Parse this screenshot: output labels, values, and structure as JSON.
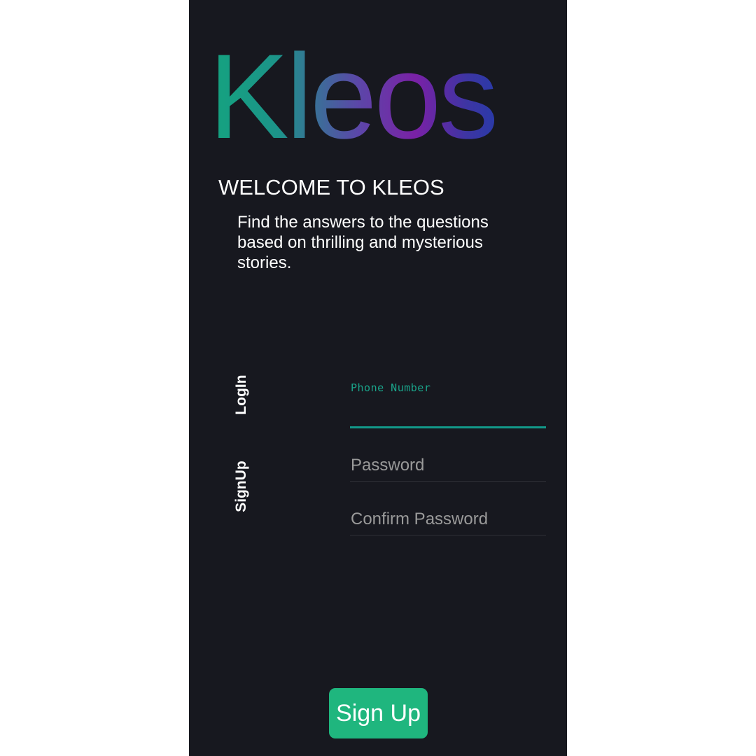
{
  "app": {
    "logo_text": "Kleos",
    "welcome_title": "WELCOME TO KLEOS",
    "subtitle": "Find the answers to the questions based on thrilling and mysterious stories."
  },
  "tabs": {
    "login_label": "LogIn",
    "signup_label": "SignUp"
  },
  "form": {
    "phone": {
      "label": "Phone Number",
      "value": ""
    },
    "password": {
      "placeholder": "Password",
      "value": ""
    },
    "confirm_password": {
      "placeholder": "Confirm Password",
      "value": ""
    },
    "submit_label": "Sign Up"
  },
  "colors": {
    "background": "#17181f",
    "accent": "#12998a",
    "button": "#1fb67e",
    "logo_gradient": [
      "#14a37f",
      "#7a21a6",
      "#2a3aa8"
    ]
  }
}
